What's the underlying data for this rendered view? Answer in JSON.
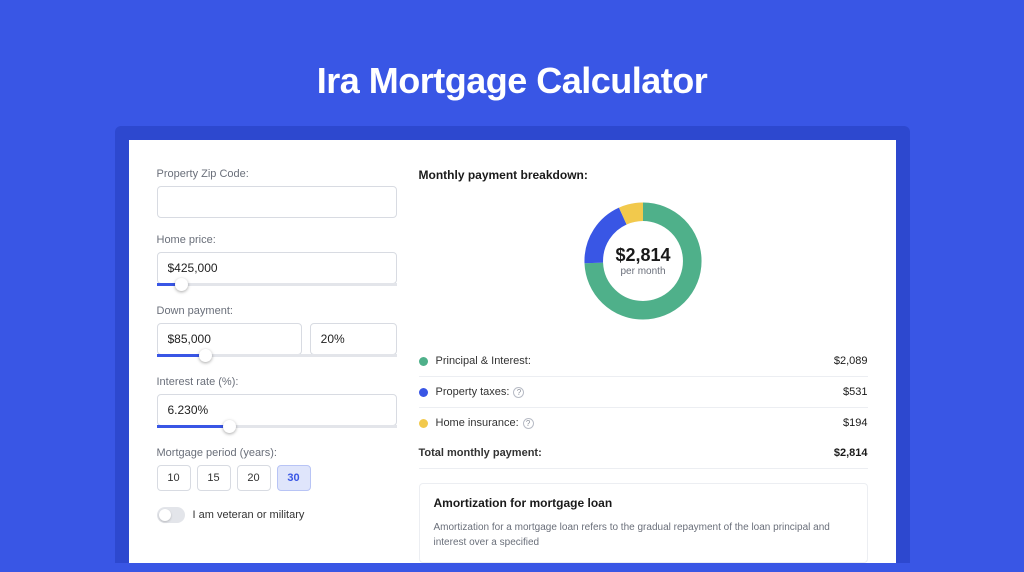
{
  "title": "Ira Mortgage Calculator",
  "form": {
    "zip_label": "Property Zip Code:",
    "zip_value": "",
    "home_price_label": "Home price:",
    "home_price_value": "$425,000",
    "home_price_slider_pct": 10,
    "down_payment_label": "Down payment:",
    "down_payment_value": "$85,000",
    "down_payment_pct": "20%",
    "down_payment_slider_pct": 20,
    "interest_label": "Interest rate (%):",
    "interest_value": "6.230%",
    "interest_slider_pct": 30,
    "period_label": "Mortgage period (years):",
    "periods": [
      "10",
      "15",
      "20",
      "30"
    ],
    "period_selected_index": 3,
    "veteran_label": "I am veteran or military",
    "veteran_on": false
  },
  "breakdown": {
    "title": "Monthly payment breakdown:",
    "center_amount": "$2,814",
    "center_sub": "per month",
    "items": [
      {
        "label": "Principal & Interest:",
        "value": "$2,089",
        "color": "#4fb08a",
        "has_info": false
      },
      {
        "label": "Property taxes:",
        "value": "$531",
        "color": "#3956e5",
        "has_info": true
      },
      {
        "label": "Home insurance:",
        "value": "$194",
        "color": "#f2c94c",
        "has_info": true
      }
    ],
    "total_label": "Total monthly payment:",
    "total_value": "$2,814"
  },
  "chart_data": {
    "type": "pie",
    "title": "Monthly payment breakdown",
    "series": [
      {
        "name": "Principal & Interest",
        "value": 2089,
        "color": "#4fb08a"
      },
      {
        "name": "Property taxes",
        "value": 531,
        "color": "#3956e5"
      },
      {
        "name": "Home insurance",
        "value": 194,
        "color": "#f2c94c"
      }
    ],
    "total": 2814,
    "center_label": "$2,814 per month"
  },
  "amort": {
    "title": "Amortization for mortgage loan",
    "text": "Amortization for a mortgage loan refers to the gradual repayment of the loan principal and interest over a specified"
  }
}
